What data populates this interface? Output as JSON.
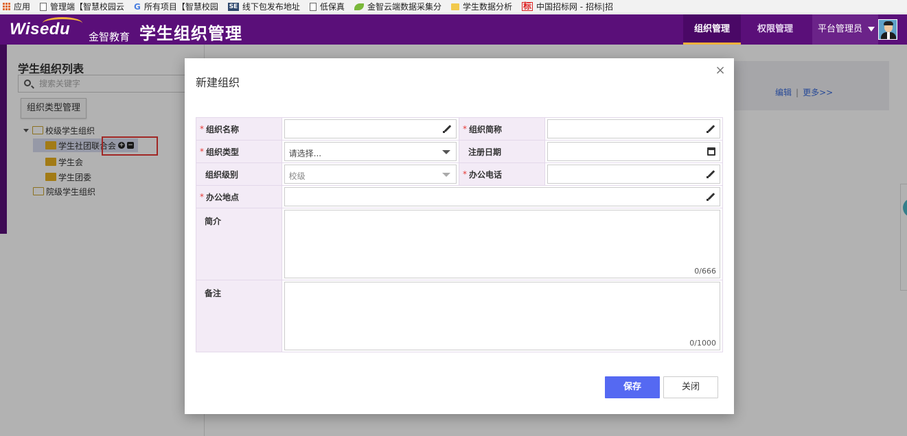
{
  "bookmarks": [
    {
      "label": "应用",
      "icon": "apps-icon"
    },
    {
      "label": "管理端【智慧校园云",
      "icon": "page-icon"
    },
    {
      "label": "所有项目【智慧校园",
      "icon": "g-icon"
    },
    {
      "label": "线下包发布地址",
      "icon": "se-icon"
    },
    {
      "label": "低保真",
      "icon": "page-icon"
    },
    {
      "label": "金智云端数据采集分",
      "icon": "leaf-icon"
    },
    {
      "label": "学生数据分析",
      "icon": "folder-icon"
    },
    {
      "label": "中国招标网 - 招标|招",
      "icon": "biao-icon"
    }
  ],
  "header": {
    "logo_text": "Wisedu",
    "logo_cn": "金智教育",
    "app_title": "学生组织管理",
    "nav": [
      {
        "label": "组织管理",
        "active": true
      },
      {
        "label": "权限管理",
        "active": false
      }
    ],
    "user_role": "平台管理员"
  },
  "left_panel": {
    "title": "学生组织列表",
    "search_placeholder": "搜索关键字",
    "type_button": "组织类型管理",
    "tree": [
      {
        "label": "校级学生组织",
        "level": 0,
        "expanded": true
      },
      {
        "label": "学生社团联合会",
        "level": 1,
        "selected": true
      },
      {
        "label": "学生会",
        "level": 1
      },
      {
        "label": "学生团委",
        "level": 1
      },
      {
        "label": "院级学生组织",
        "level": 0,
        "expanded": false
      }
    ],
    "node_actions": [
      "+",
      "−"
    ]
  },
  "card": {
    "edit_link": "编辑",
    "separator": "|",
    "more_link": "更多>>"
  },
  "modal": {
    "title": "新建组织",
    "close_glyph": "×",
    "fields": {
      "name": {
        "label": "组织名称",
        "required": true,
        "value": ""
      },
      "short_name": {
        "label": "组织简称",
        "required": true,
        "value": ""
      },
      "type": {
        "label": "组织类型",
        "required": true,
        "value": "请选择..."
      },
      "reg_date": {
        "label": "注册日期",
        "required": false,
        "value": ""
      },
      "level": {
        "label": "组织级别",
        "required": false,
        "value": "校级"
      },
      "phone": {
        "label": "办公电话",
        "required": true,
        "value": ""
      },
      "location": {
        "label": "办公地点",
        "required": true,
        "value": ""
      },
      "intro": {
        "label": "简介",
        "required": false,
        "counter": "0/666"
      },
      "remark": {
        "label": "备注",
        "required": false,
        "counter": "0/1000"
      }
    },
    "required_mark": "*",
    "save_label": "保存",
    "close_label": "关闭"
  }
}
